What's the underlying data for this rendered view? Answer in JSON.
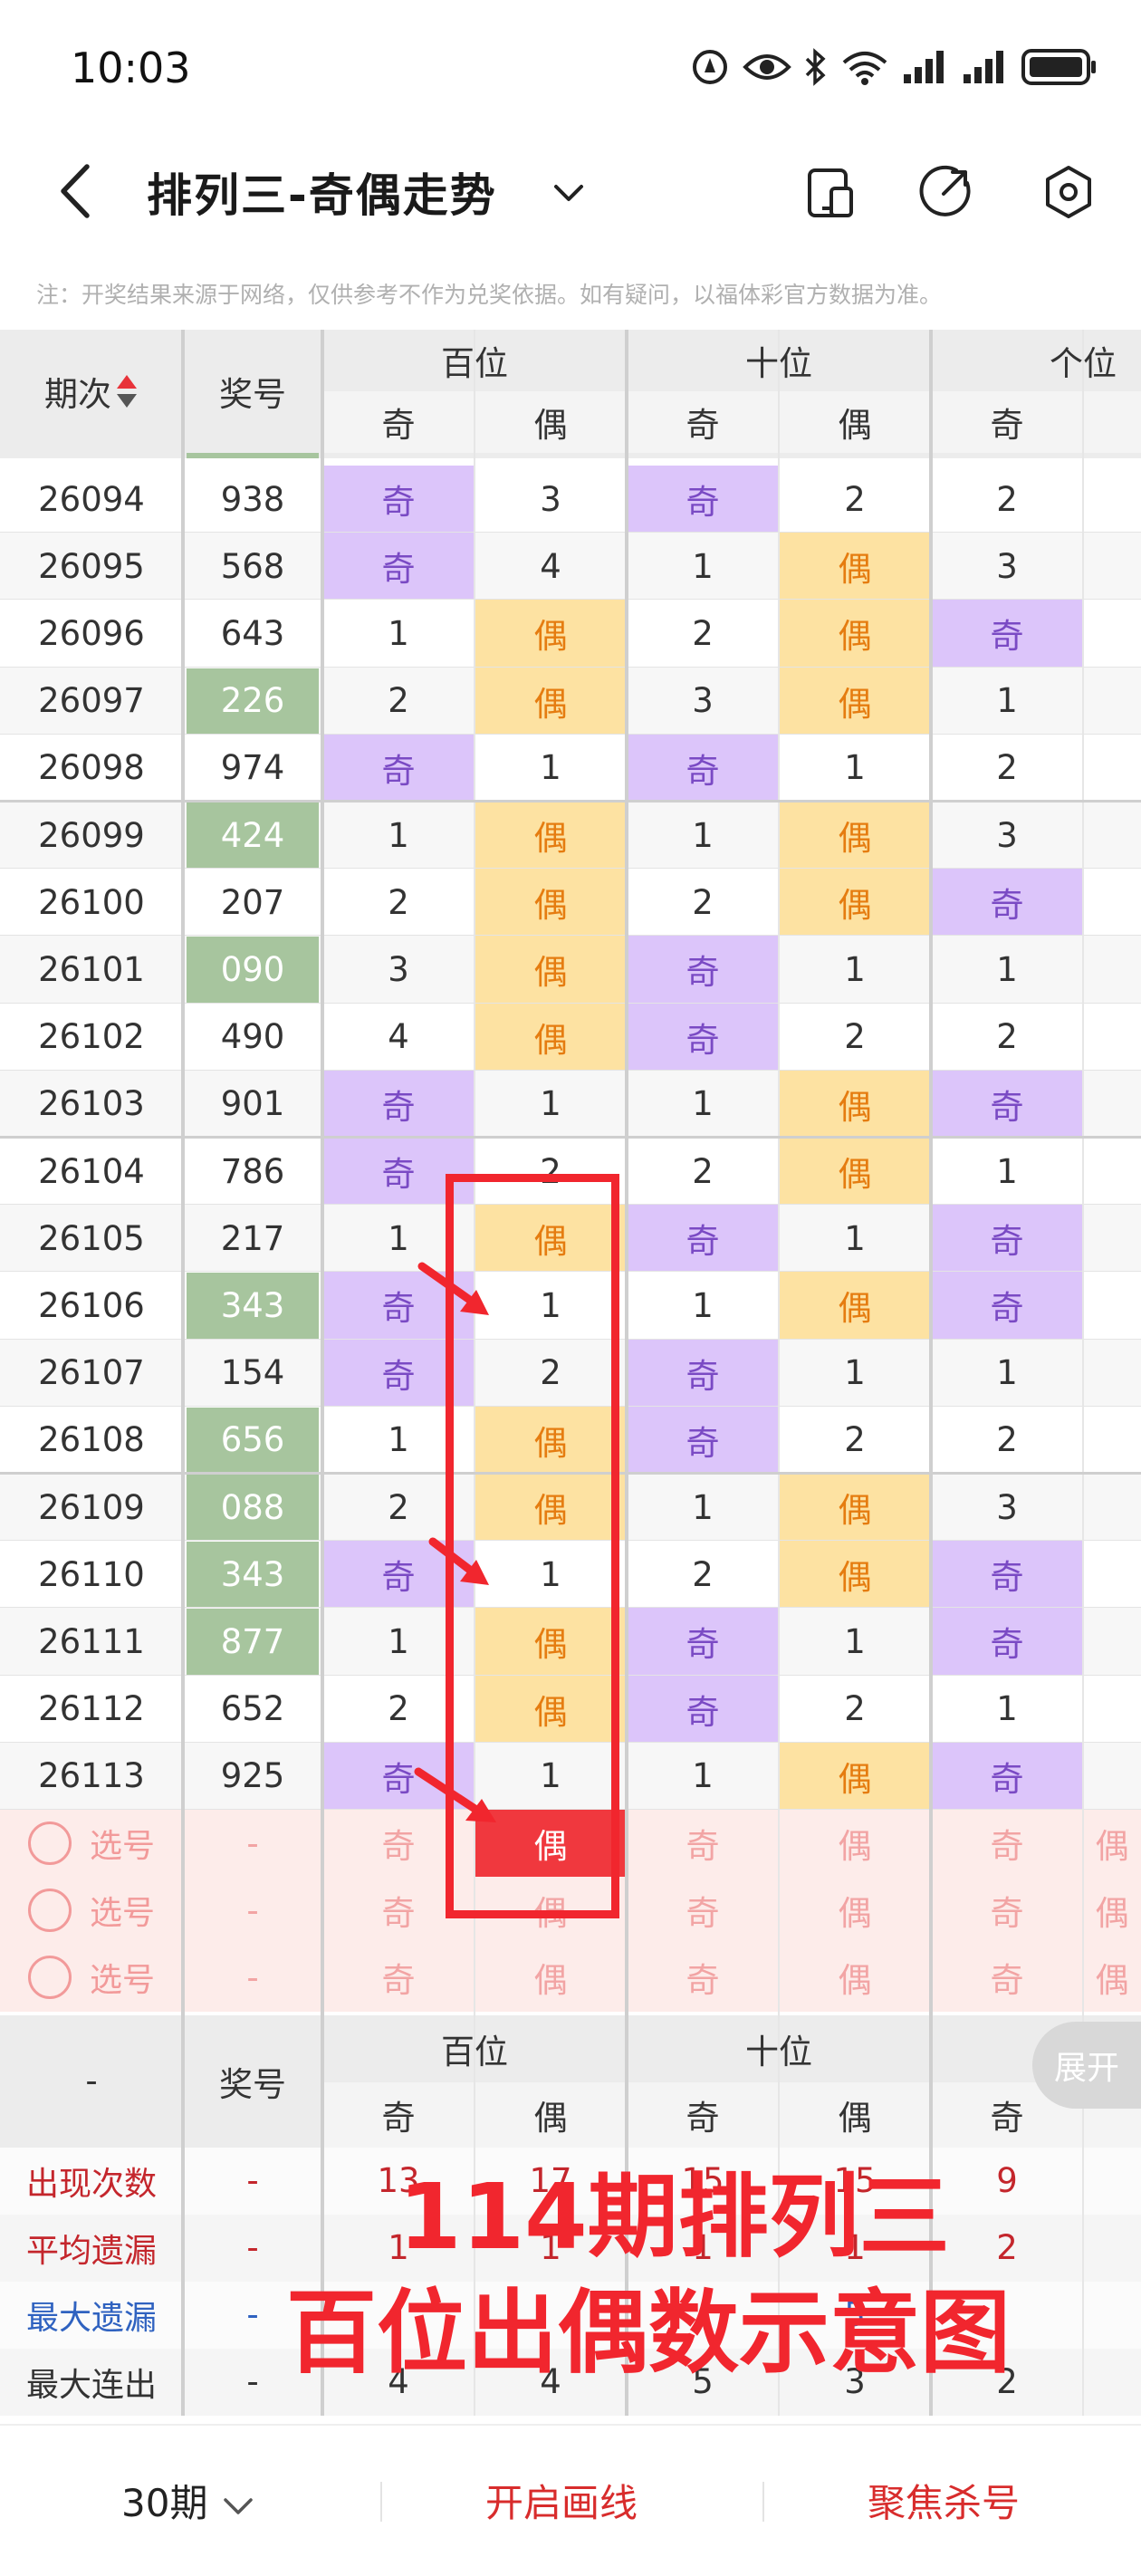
{
  "status": {
    "time": "10:03"
  },
  "header": {
    "title": "排列三-奇偶走势"
  },
  "disclaimer": "注：开奖结果来源于网络，仅供参考不作为兑奖依据。如有疑问，以福体彩官方数据为准。",
  "table": {
    "col_issue": "期次",
    "col_number": "奖号",
    "groups": [
      "百位",
      "十位",
      "个位"
    ],
    "odd": "奇",
    "even": "偶",
    "rows": [
      {
        "issue": "26094",
        "num": "938",
        "hl": false,
        "h": [
          "奇",
          "3"
        ],
        "t": [
          "奇",
          "2"
        ],
        "u": [
          "2",
          ""
        ]
      },
      {
        "issue": "26095",
        "num": "568",
        "hl": false,
        "h": [
          "奇",
          "4"
        ],
        "t": [
          "1",
          "偶"
        ],
        "u": [
          "3",
          ""
        ]
      },
      {
        "issue": "26096",
        "num": "643",
        "hl": false,
        "h": [
          "1",
          "偶"
        ],
        "t": [
          "2",
          "偶"
        ],
        "u": [
          "奇",
          ""
        ]
      },
      {
        "issue": "26097",
        "num": "226",
        "hl": true,
        "h": [
          "2",
          "偶"
        ],
        "t": [
          "3",
          "偶"
        ],
        "u": [
          "1",
          ""
        ]
      },
      {
        "issue": "26098",
        "num": "974",
        "hl": false,
        "h": [
          "奇",
          "1"
        ],
        "t": [
          "奇",
          "1"
        ],
        "u": [
          "2",
          ""
        ]
      },
      {
        "issue": "26099",
        "num": "424",
        "hl": true,
        "h": [
          "1",
          "偶"
        ],
        "t": [
          "1",
          "偶"
        ],
        "u": [
          "3",
          ""
        ]
      },
      {
        "issue": "26100",
        "num": "207",
        "hl": false,
        "h": [
          "2",
          "偶"
        ],
        "t": [
          "2",
          "偶"
        ],
        "u": [
          "奇",
          ""
        ]
      },
      {
        "issue": "26101",
        "num": "090",
        "hl": true,
        "h": [
          "3",
          "偶"
        ],
        "t": [
          "奇",
          "1"
        ],
        "u": [
          "1",
          ""
        ]
      },
      {
        "issue": "26102",
        "num": "490",
        "hl": false,
        "h": [
          "4",
          "偶"
        ],
        "t": [
          "奇",
          "2"
        ],
        "u": [
          "2",
          ""
        ]
      },
      {
        "issue": "26103",
        "num": "901",
        "hl": false,
        "h": [
          "奇",
          "1"
        ],
        "t": [
          "1",
          "偶"
        ],
        "u": [
          "奇",
          ""
        ]
      },
      {
        "issue": "26104",
        "num": "786",
        "hl": false,
        "h": [
          "奇",
          "2"
        ],
        "t": [
          "2",
          "偶"
        ],
        "u": [
          "1",
          ""
        ]
      },
      {
        "issue": "26105",
        "num": "217",
        "hl": false,
        "h": [
          "1",
          "偶"
        ],
        "t": [
          "奇",
          "1"
        ],
        "u": [
          "奇",
          ""
        ]
      },
      {
        "issue": "26106",
        "num": "343",
        "hl": true,
        "h": [
          "奇",
          "1"
        ],
        "t": [
          "1",
          "偶"
        ],
        "u": [
          "奇",
          ""
        ]
      },
      {
        "issue": "26107",
        "num": "154",
        "hl": false,
        "h": [
          "奇",
          "2"
        ],
        "t": [
          "奇",
          "1"
        ],
        "u": [
          "1",
          ""
        ]
      },
      {
        "issue": "26108",
        "num": "656",
        "hl": true,
        "h": [
          "1",
          "偶"
        ],
        "t": [
          "奇",
          "2"
        ],
        "u": [
          "2",
          ""
        ]
      },
      {
        "issue": "26109",
        "num": "088",
        "hl": true,
        "h": [
          "2",
          "偶"
        ],
        "t": [
          "1",
          "偶"
        ],
        "u": [
          "3",
          ""
        ]
      },
      {
        "issue": "26110",
        "num": "343",
        "hl": true,
        "h": [
          "奇",
          "1"
        ],
        "t": [
          "2",
          "偶"
        ],
        "u": [
          "奇",
          ""
        ]
      },
      {
        "issue": "26111",
        "num": "877",
        "hl": true,
        "h": [
          "1",
          "偶"
        ],
        "t": [
          "奇",
          "1"
        ],
        "u": [
          "奇",
          ""
        ]
      },
      {
        "issue": "26112",
        "num": "652",
        "hl": false,
        "h": [
          "2",
          "偶"
        ],
        "t": [
          "奇",
          "2"
        ],
        "u": [
          "1",
          ""
        ]
      },
      {
        "issue": "26113",
        "num": "925",
        "hl": false,
        "h": [
          "奇",
          "1"
        ],
        "t": [
          "1",
          "偶"
        ],
        "u": [
          "奇",
          ""
        ]
      }
    ],
    "pick_label": "选号",
    "pick_dash": "-",
    "stats_dash": "-",
    "stats_number_label": "奖号",
    "stats": [
      {
        "label": "出现次数",
        "style": "red",
        "vals": [
          "-",
          "13",
          "17",
          "15",
          "15",
          "9"
        ]
      },
      {
        "label": "平均遗漏",
        "style": "red",
        "vals": [
          "-",
          "1",
          "1",
          "1",
          "1",
          "2"
        ]
      },
      {
        "label": "最大遗漏",
        "style": "blue",
        "vals": [
          "-",
          "",
          "",
          "",
          "5",
          ""
        ]
      },
      {
        "label": "最大连出",
        "style": "dark",
        "vals": [
          "-",
          "4",
          "4",
          "5",
          "3",
          "2"
        ]
      }
    ],
    "expand": "展开"
  },
  "overlay": {
    "line1": "114期排列三",
    "line2": "百位出偶数示意图"
  },
  "bottom": {
    "period": "30期",
    "draw_line": "开启画线",
    "focus_kill": "聚焦杀号"
  },
  "colors": {
    "odd_bg": "#dcc5fa",
    "even_bg": "#fde2a2",
    "hot_bg": "#a7c59e",
    "accent": "#f1262e"
  }
}
